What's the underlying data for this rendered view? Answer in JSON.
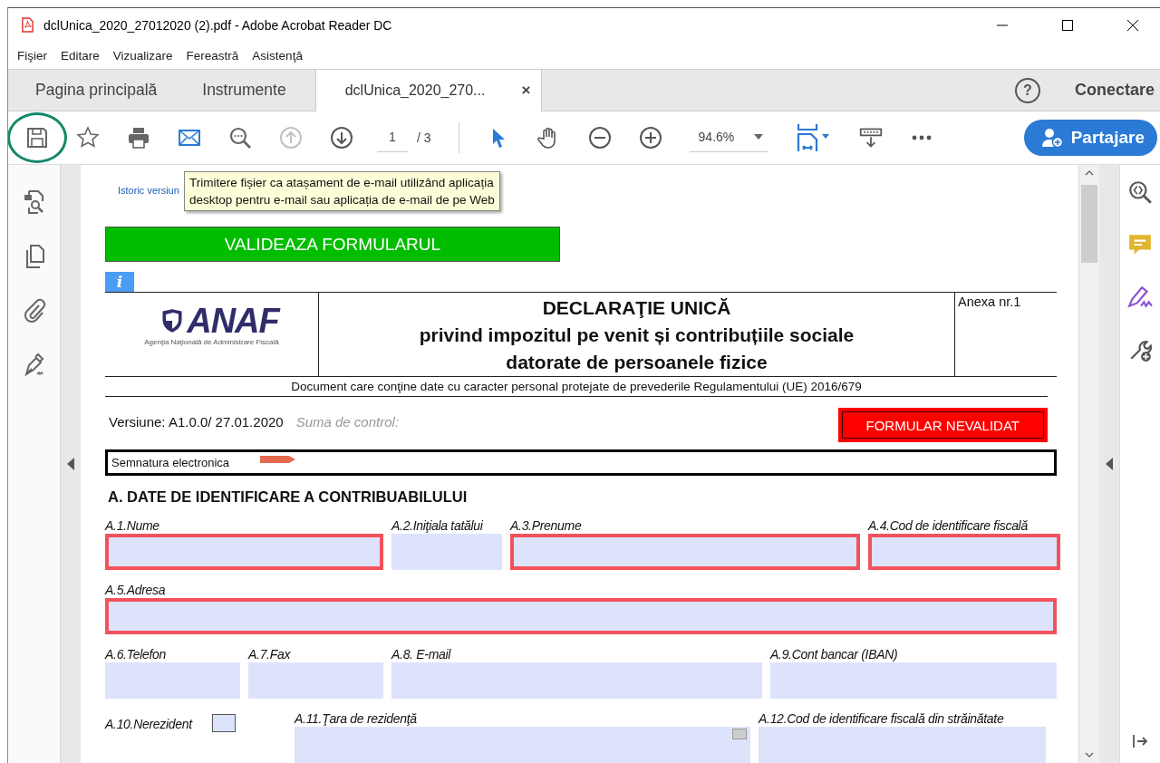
{
  "window": {
    "title": "dclUnica_2020_27012020 (2).pdf - Adobe Acrobat Reader DC"
  },
  "menu": [
    "Fişier",
    "Editare",
    "Vizualizare",
    "Fereastră",
    "Asistenţă"
  ],
  "tabs": [
    {
      "label": "Pagina principală",
      "selected": false
    },
    {
      "label": "Instrumente",
      "selected": false
    },
    {
      "label": "dclUnica_2020_270...",
      "selected": true,
      "close": "×"
    }
  ],
  "help": "?",
  "account": "Conectare",
  "toolbar": {
    "save_highlighted": true,
    "prev_page_disabled": true,
    "page": "1",
    "page_separator": "/",
    "page_total": "3",
    "zoom": "94.6%",
    "share_button": "Partajare"
  },
  "tooltip": "Trimitere fișier ca atașament de e-mail utilizând aplicația\ndesktop pentru e-mail sau aplicația de e-mail de pe Web",
  "document": {
    "history_link": "Istoric versiun",
    "validate_button": "VALIDEAZA FORMULARUL",
    "info_button": "i",
    "logo": {
      "text": "ANAF",
      "subtitle": "Agenţia Naţională de Administrare Fiscală"
    },
    "title_lines": [
      "DECLARAŢIE UNICĂ",
      "privind impozitul pe venit și contribuțiile sociale",
      "datorate de persoanele fizice"
    ],
    "annex": "Anexa nr.1",
    "notice": "Document care conţine date cu caracter personal protejate de prevederile Regulamentului (UE) 2016/679",
    "version": "Versiune:  A1.0.0/ 27.01.2020",
    "checksum_label": "Suma de  control:",
    "status": "FORMULAR NEVALIDAT",
    "signature_label": "Semnatura electronica",
    "section_title": "A. DATE DE IDENTIFICARE A CONTRIBUABILULUI",
    "rows": [
      {
        "fields": [
          {
            "label": "A.1.Nume",
            "kind": "text",
            "required": true
          },
          {
            "label": "A.2.Iniţiala tatălui",
            "kind": "text",
            "required": false
          },
          {
            "label": "A.3.Prenume",
            "kind": "text",
            "required": true
          },
          {
            "label": "A.4.Cod de identificare fiscală",
            "kind": "text",
            "required": true
          }
        ]
      },
      {
        "fields": [
          {
            "label": "A.5.Adresa",
            "kind": "text",
            "required": true
          }
        ]
      },
      {
        "fields": [
          {
            "label": "A.6.Telefon",
            "kind": "text",
            "required": false
          },
          {
            "label": "A.7.Fax",
            "kind": "text",
            "required": false
          },
          {
            "label": "A.8. E-mail",
            "kind": "text",
            "required": false
          },
          {
            "label": "A.9.Cont bancar (IBAN)",
            "kind": "text",
            "required": false
          }
        ]
      },
      {
        "fields": [
          {
            "label": "A.10.Nerezident",
            "kind": "checkbox",
            "checked": false
          },
          {
            "label": "A.11.Ţara de rezidenţă",
            "kind": "dropdown",
            "required": false
          },
          {
            "label": "A.12.Cod de identificare fiscală din străinătate",
            "kind": "text",
            "required": false
          }
        ]
      }
    ]
  }
}
